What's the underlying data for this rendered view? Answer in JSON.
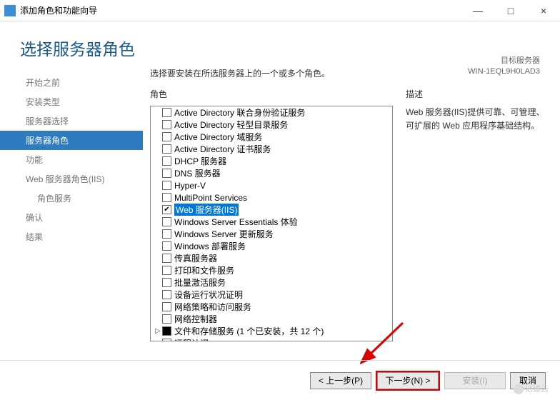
{
  "window": {
    "title": "添加角色和功能向导",
    "min": "—",
    "max": "□",
    "close": "×"
  },
  "header": {
    "page_title": "选择服务器角色",
    "target_label": "目标服务器",
    "target_value": "WIN-1EQL9H0LAD3"
  },
  "sidebar": {
    "items": [
      "开始之前",
      "安装类型",
      "服务器选择",
      "服务器角色",
      "功能",
      "Web 服务器角色(IIS)",
      "角色服务",
      "确认",
      "结果"
    ]
  },
  "main": {
    "instruction": "选择要安装在所选服务器上的一个或多个角色。",
    "roles_label": "角色",
    "desc_label": "描述",
    "desc_text": "Web 服务器(IIS)提供可靠、可管理、可扩展的 Web 应用程序基础结构。"
  },
  "roles": [
    {
      "label": "Active Directory 联合身份验证服务",
      "checked": false
    },
    {
      "label": "Active Directory 轻型目录服务",
      "checked": false
    },
    {
      "label": "Active Directory 域服务",
      "checked": false
    },
    {
      "label": "Active Directory 证书服务",
      "checked": false
    },
    {
      "label": "DHCP 服务器",
      "checked": false
    },
    {
      "label": "DNS 服务器",
      "checked": false
    },
    {
      "label": "Hyper-V",
      "checked": false
    },
    {
      "label": "MultiPoint Services",
      "checked": false
    },
    {
      "label": "Web 服务器(IIS)",
      "checked": true,
      "selected": true
    },
    {
      "label": "Windows Server Essentials 体验",
      "checked": false
    },
    {
      "label": "Windows Server 更新服务",
      "checked": false
    },
    {
      "label": "Windows 部署服务",
      "checked": false
    },
    {
      "label": "传真服务器",
      "checked": false
    },
    {
      "label": "打印和文件服务",
      "checked": false
    },
    {
      "label": "批量激活服务",
      "checked": false
    },
    {
      "label": "设备运行状况证明",
      "checked": false
    },
    {
      "label": "网络策略和访问服务",
      "checked": false
    },
    {
      "label": "网络控制器",
      "checked": false
    },
    {
      "label": "文件和存储服务 (1 个已安装，共 12 个)",
      "checked": false,
      "filled": true,
      "expandable": true
    },
    {
      "label": "远程访问",
      "checked": false
    }
  ],
  "footer": {
    "prev": "< 上一步(P)",
    "next": "下一步(N) >",
    "install": "安装(I)",
    "cancel": "取消"
  },
  "watermark": "亿速云"
}
